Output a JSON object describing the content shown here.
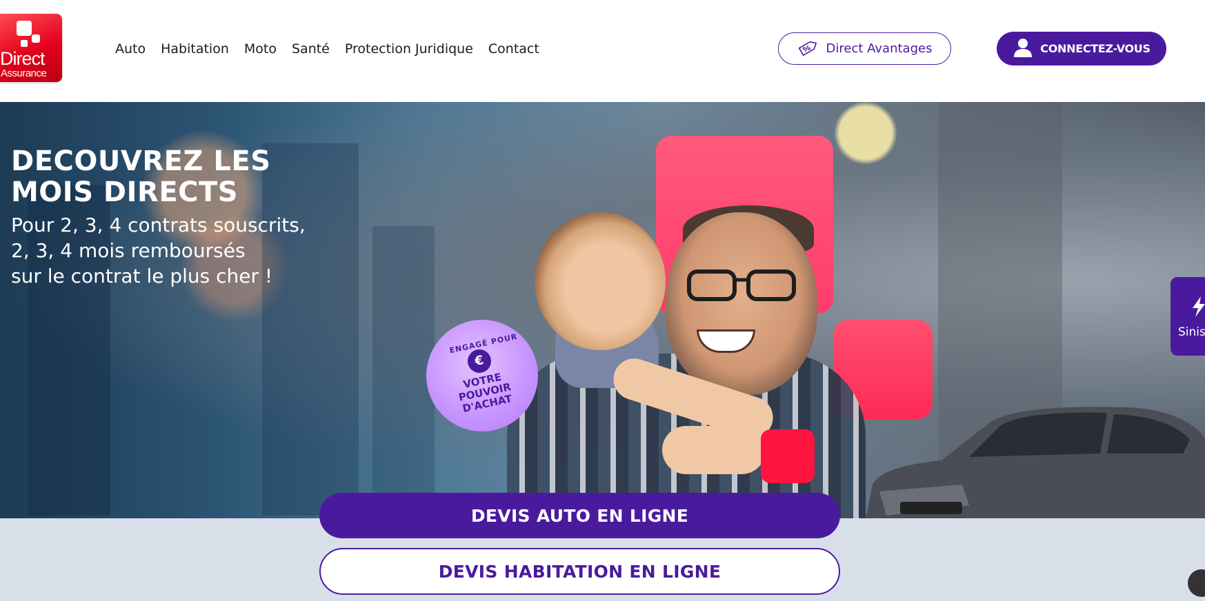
{
  "brand": {
    "logo_line1": "Direct",
    "logo_line2": "Assurance"
  },
  "nav": {
    "items": [
      {
        "label": "Auto"
      },
      {
        "label": "Habitation"
      },
      {
        "label": "Moto"
      },
      {
        "label": "Santé"
      },
      {
        "label": "Protection Juridique"
      },
      {
        "label": "Contact"
      }
    ]
  },
  "header_actions": {
    "avantages_label": "Direct Avantages",
    "avantages_icon": "tag-percent-icon",
    "connect_label": "CONNECTEZ-VOUS",
    "connect_icon": "user-icon"
  },
  "hero": {
    "title": "DECOUVREZ LES\nMOIS DIRECTS",
    "subtitle": "Pour 2, 3, 4 contrats souscrits,\n2, 3, 4 mois remboursés\nsur le contrat le plus cher !",
    "badge_top": "ENGAGÉ POUR",
    "badge_symbol": "€",
    "badge_main": "VOTRE\nPOUVOIR\nD'ACHAT"
  },
  "side_tab": {
    "label": "Sinis",
    "icon": "lightning-icon"
  },
  "cta": {
    "auto_label": "DEVIS AUTO EN LIGNE",
    "habitation_label": "DEVIS HABITATION EN LIGNE"
  },
  "colors": {
    "primary": "#4a1a9e",
    "brand_red": "#e3001b",
    "accent_pink": "#ff3c6a",
    "band_bg": "#d8dfe9"
  }
}
